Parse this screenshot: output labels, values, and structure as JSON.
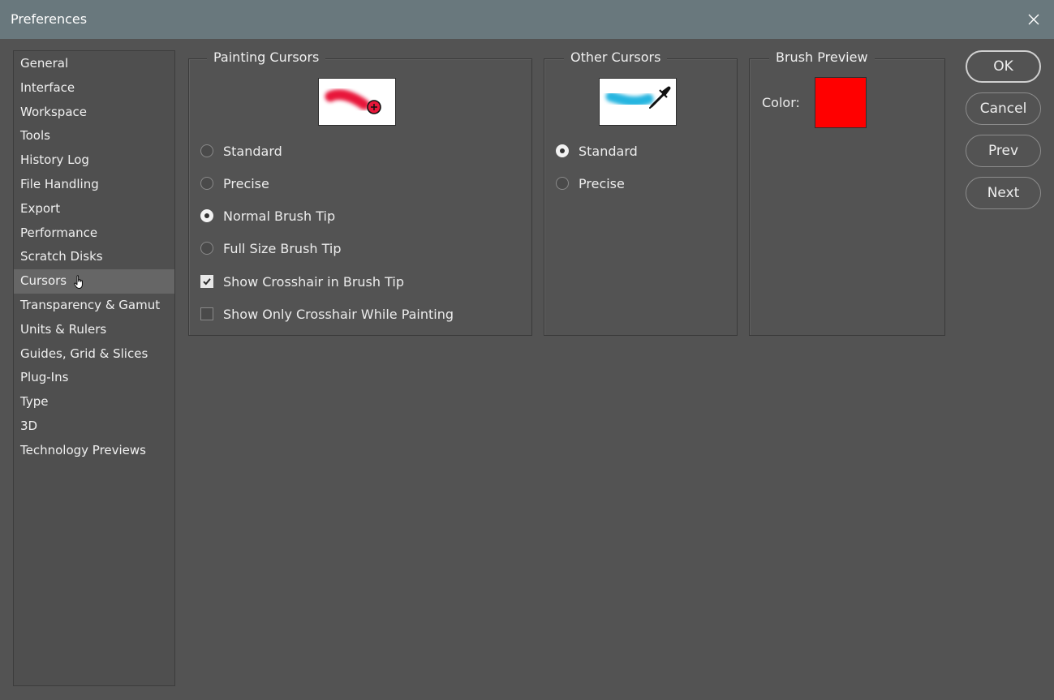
{
  "window": {
    "title": "Preferences"
  },
  "sidebar": {
    "items": [
      {
        "label": "General"
      },
      {
        "label": "Interface"
      },
      {
        "label": "Workspace"
      },
      {
        "label": "Tools"
      },
      {
        "label": "History Log"
      },
      {
        "label": "File Handling"
      },
      {
        "label": "Export"
      },
      {
        "label": "Performance"
      },
      {
        "label": "Scratch Disks"
      },
      {
        "label": "Cursors",
        "selected": true
      },
      {
        "label": "Transparency & Gamut"
      },
      {
        "label": "Units & Rulers"
      },
      {
        "label": "Guides, Grid & Slices"
      },
      {
        "label": "Plug-Ins"
      },
      {
        "label": "Type"
      },
      {
        "label": "3D"
      },
      {
        "label": "Technology Previews"
      }
    ]
  },
  "painting_cursors": {
    "label": "Painting Cursors",
    "options": [
      {
        "label": "Standard",
        "checked": false
      },
      {
        "label": "Precise",
        "checked": false
      },
      {
        "label": "Normal Brush Tip",
        "checked": true
      },
      {
        "label": "Full Size Brush Tip",
        "checked": false
      }
    ],
    "checkboxes": [
      {
        "label": "Show Crosshair in Brush Tip",
        "checked": true
      },
      {
        "label": "Show Only Crosshair While Painting",
        "checked": false
      }
    ]
  },
  "other_cursors": {
    "label": "Other Cursors",
    "options": [
      {
        "label": "Standard",
        "checked": true
      },
      {
        "label": "Precise",
        "checked": false
      }
    ]
  },
  "brush_preview": {
    "label": "Brush Preview",
    "color_label": "Color:",
    "color": "#ff0000"
  },
  "buttons": {
    "ok": "OK",
    "cancel": "Cancel",
    "prev": "Prev",
    "next": "Next"
  },
  "colors": {
    "titlebar": "#69787d",
    "background": "#535353",
    "selected_item": "#666666",
    "painting_stroke": "#e8173a",
    "other_stroke": "#27b5e0"
  }
}
